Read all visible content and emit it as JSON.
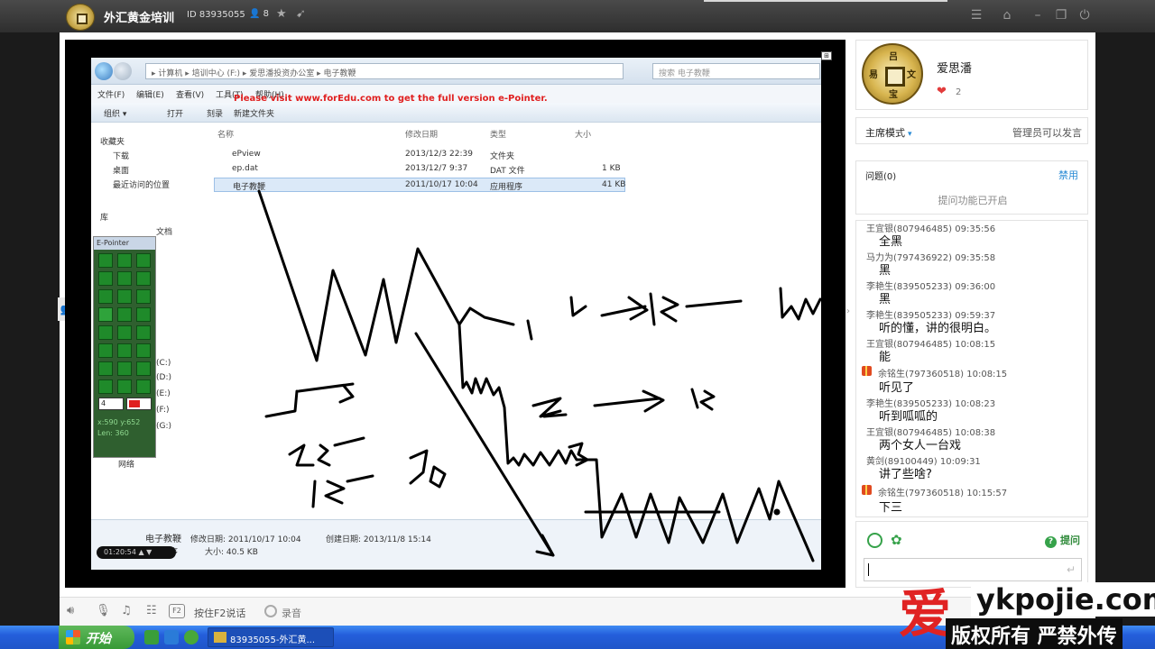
{
  "header": {
    "title": "外汇黄金培训",
    "room_id": "ID 83935055",
    "people_count": "8"
  },
  "explorer": {
    "path": "▸ 计算机 ▸ 培训中心 (F:) ▸ 爱思潘投资办公室 ▸ 电子教鞭",
    "search_placeholder": "搜索 电子教鞭",
    "menu": [
      "文件(F)",
      "编辑(E)",
      "查看(V)",
      "工具(T)",
      "帮助(H)"
    ],
    "watermark": "Please visit www.forEdu.com to get the full version e-Pointer.",
    "commands": [
      "组织 ▾",
      "打开",
      "刻录",
      "新建文件夹"
    ],
    "nav_items": [
      "收藏夹",
      "下载",
      "桌面",
      "最近访问的位置",
      "库",
      "文档",
      "(C:)",
      "(D:)",
      "(E:)",
      "(F:)",
      "(G:)",
      "网络"
    ],
    "columns": [
      "名称",
      "修改日期",
      "类型",
      "大小"
    ],
    "files": [
      {
        "name": "ePview",
        "date": "2013/12/3 22:39",
        "type": "文件夹",
        "size": ""
      },
      {
        "name": "ep.dat",
        "date": "2013/12/7 9:37",
        "type": "DAT 文件",
        "size": "1 KB"
      },
      {
        "name": "电子教鞭",
        "date": "2011/10/17 10:04",
        "type": "应用程序",
        "size": "41 KB"
      }
    ],
    "details": {
      "name": "电子教鞭",
      "modified": "修改日期: 2011/10/17 10:04",
      "created": "创建日期: 2013/11/8 15:14",
      "size": "大小: 40.5 KB",
      "type": "应用程序"
    }
  },
  "epointer": {
    "title": "E-Pointer",
    "size_value": "4",
    "coords": [
      "x:590  y:652",
      "Len: 360"
    ],
    "pen_color": "#e02020"
  },
  "timer": "01:20:54",
  "timer_icons": "▲ ▼",
  "host": {
    "name": "爱思潘",
    "likes": "2",
    "seal_chars": [
      "吕",
      "文",
      "宝",
      "易"
    ]
  },
  "mode": {
    "label": "主席模式",
    "permission": "管理员可以发言"
  },
  "qa": {
    "title": "问题(0)",
    "disable": "禁用",
    "status": "提问功能已开启"
  },
  "chat": [
    {
      "user": "王宜银(807946485) 09:35:56",
      "text": "全黑",
      "gift": false
    },
    {
      "user": "马力为(797436922) 09:35:58",
      "text": "黑",
      "gift": false
    },
    {
      "user": "李艳生(839505233) 09:36:00",
      "text": "黑",
      "gift": false
    },
    {
      "user": "李艳生(839505233) 09:59:37",
      "text": "听的懂，讲的很明白。",
      "gift": false
    },
    {
      "user": "王宜银(807946485) 10:08:15",
      "text": "能",
      "gift": false
    },
    {
      "user": "余铭生(797360518) 10:08:15",
      "text": "听见了",
      "gift": true
    },
    {
      "user": "李艳生(839505233) 10:08:23",
      "text": "听到呱呱的",
      "gift": false
    },
    {
      "user": "王宜银(807946485) 10:08:38",
      "text": "两个女人一台戏",
      "gift": false
    },
    {
      "user": "黄剑(89100449) 10:09:31",
      "text": "讲了些啥?",
      "gift": false
    },
    {
      "user": "余铭生(797360518) 10:15:57",
      "text": "下三",
      "gift": true
    }
  ],
  "composer": {
    "ask_label": "提问"
  },
  "bottom": {
    "f2": "F2",
    "ptt": "按住F2说话",
    "record": "录音"
  },
  "taskbar": {
    "start": "开始",
    "task_title": "83935055-外汇黄..."
  },
  "brand": {
    "ai": "爱",
    "site": "ykpojie.com",
    "sub": "版权所有 严禁外传"
  },
  "colors": {
    "accent_blue": "#2a8bd5",
    "ask_green": "#36a24a",
    "heart": "#e23c3c",
    "taskbar": "#245edb"
  }
}
